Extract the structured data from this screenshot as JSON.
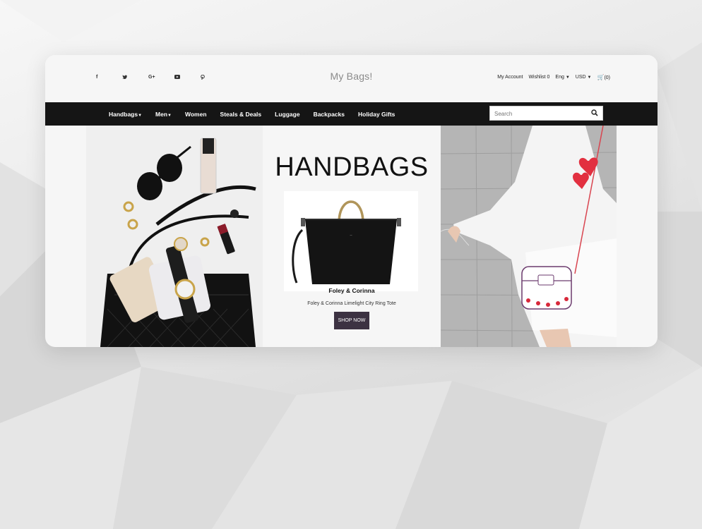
{
  "topbar": {
    "social": [
      "f",
      "t",
      "G+",
      "yt",
      "p"
    ],
    "brand": "My Bags!",
    "my_account": "My Account",
    "wishlist": "Wishlist 0",
    "language": "Eng",
    "currency": "USD",
    "cart": "(0)"
  },
  "nav": {
    "items": [
      "Handbags",
      "Men",
      "Women",
      "Steals & Deals",
      "Luggage",
      "Backpacks",
      "Holiday Gifts"
    ],
    "search_placeholder": "Search"
  },
  "hero": {
    "title": "HANDBAGS",
    "product_name": "Foley & Corinna",
    "product_description": "Foley & Corinna Limelight City Ring Tote",
    "cta": "SHOP NOW"
  },
  "colors": {
    "nav_bg": "#151515",
    "button_bg": "#3c3242",
    "cart_icon": "#e0a800"
  }
}
